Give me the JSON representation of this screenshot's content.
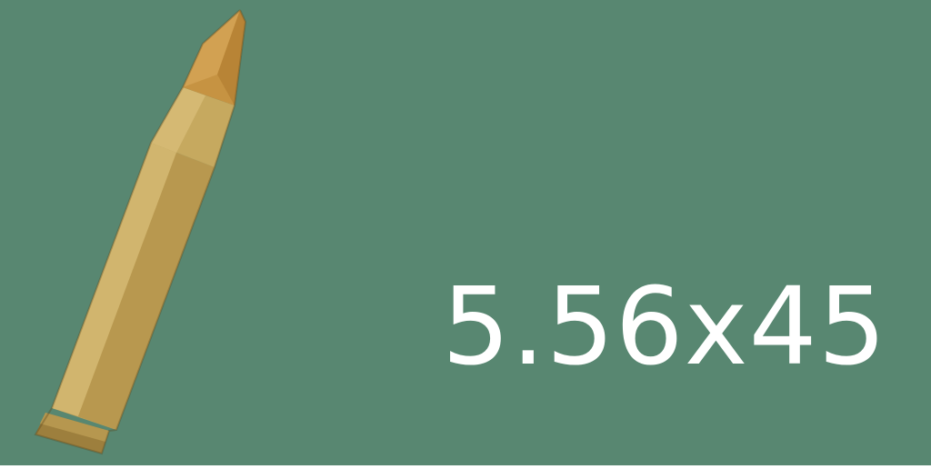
{
  "background_color": "#588771",
  "item": {
    "icon": "rifle-cartridge-icon",
    "caliber_label": "5.56x45",
    "label_color": "#ffffff",
    "casing_color": "#c8a85c",
    "bullet_color": "#c99448"
  }
}
